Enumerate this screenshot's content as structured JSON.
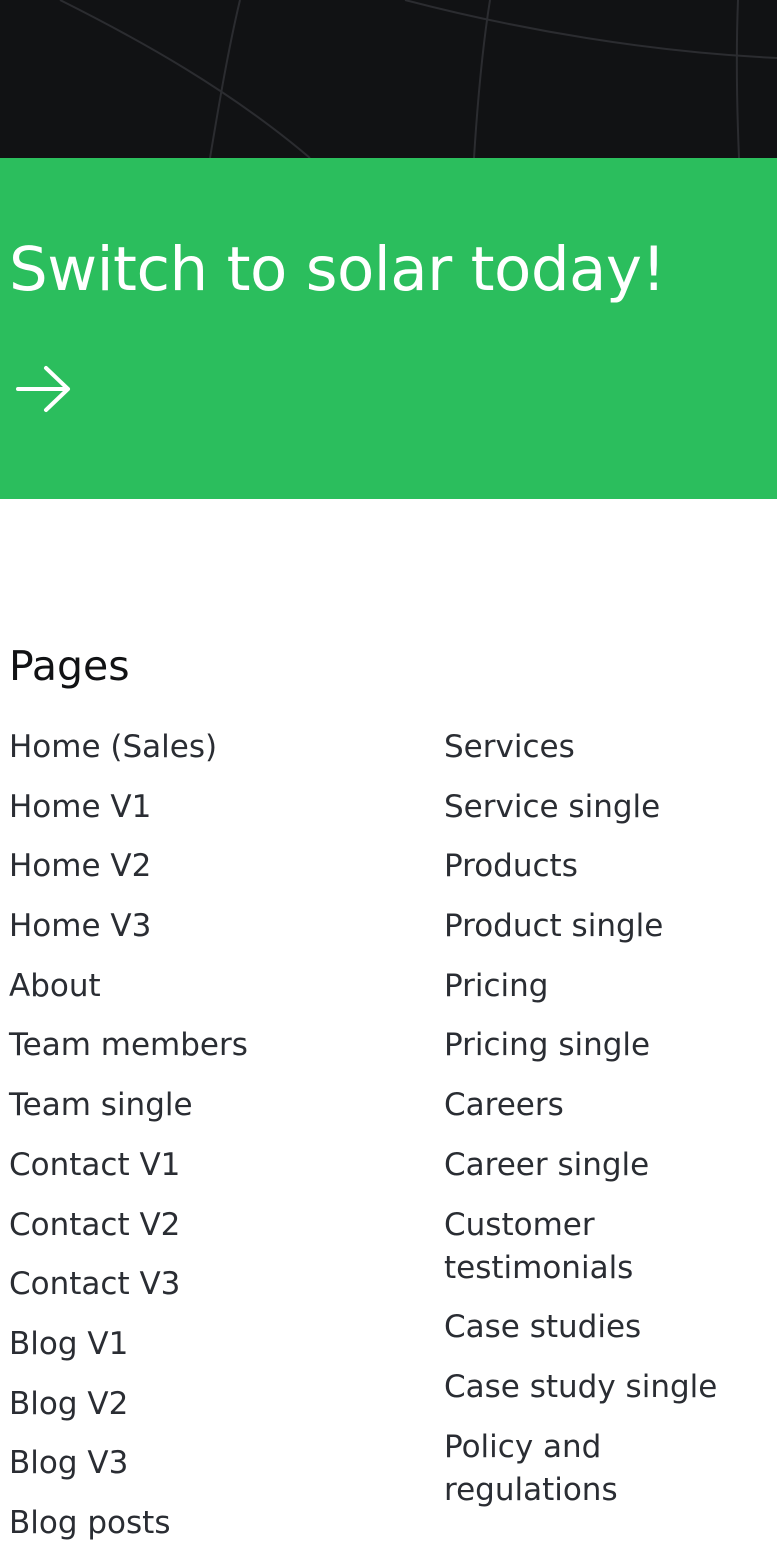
{
  "cta": {
    "title": "Switch to solar today!",
    "arrow_icon": "arrow-right-icon",
    "background": "#2bbe5d"
  },
  "hero": {
    "background": "#111214"
  },
  "pages": {
    "heading": "Pages",
    "left": [
      "Home (Sales)",
      "Home V1",
      "Home V2",
      "Home V3",
      "About",
      "Team members",
      "Team single",
      "Contact V1",
      "Contact V2",
      "Contact V3",
      "Blog V1",
      "Blog V2",
      "Blog V3",
      "Blog posts"
    ],
    "right": [
      "Services",
      "Service single",
      "Products",
      "Product single",
      "Pricing",
      "Pricing single",
      "Careers",
      "Career single",
      "Customer testimonials",
      "Case studies",
      "Case study single",
      "Policy and regulations"
    ]
  }
}
